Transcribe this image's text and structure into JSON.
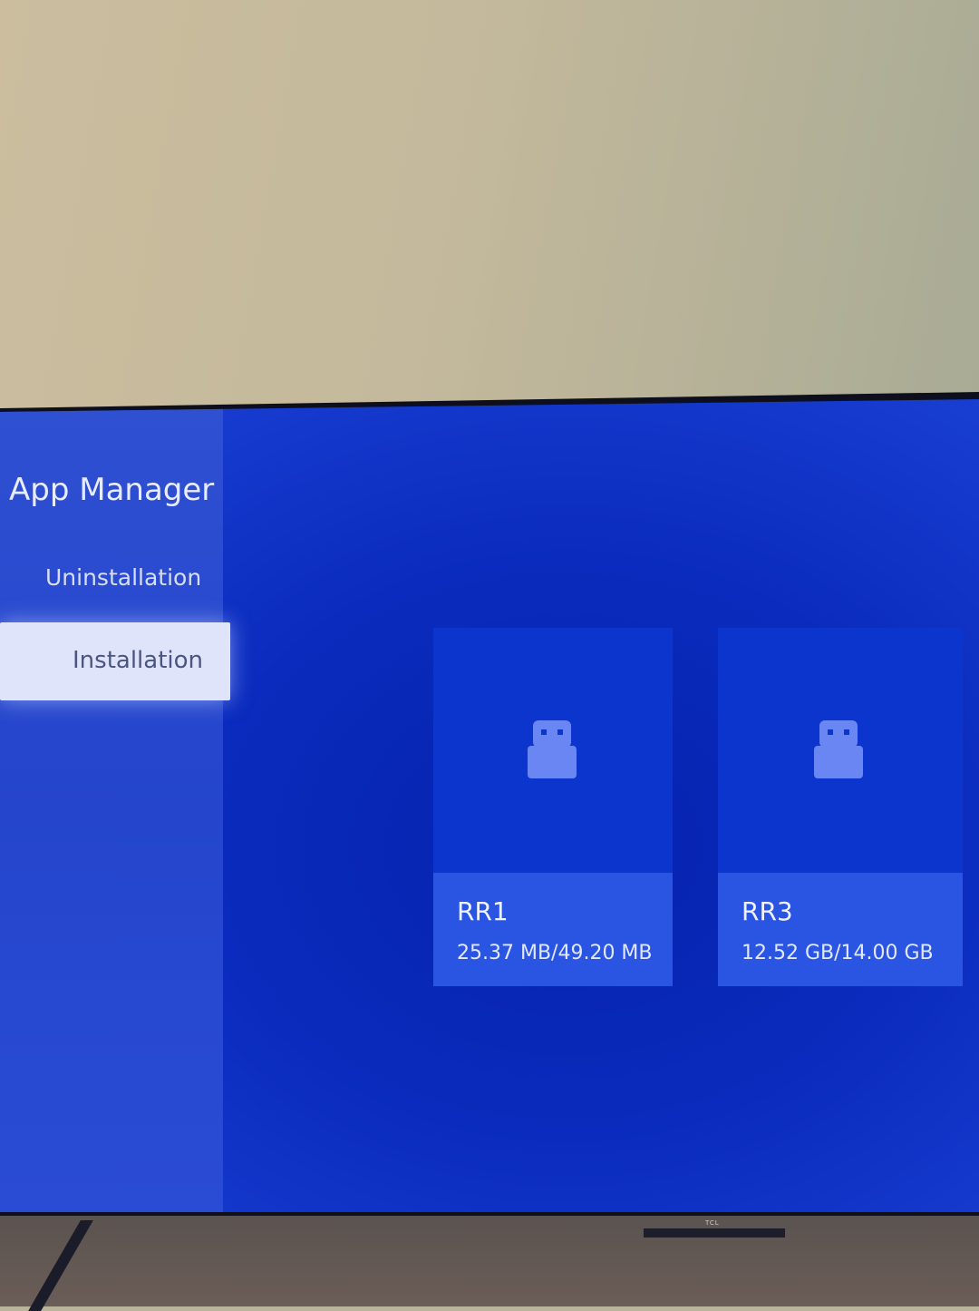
{
  "app": {
    "title": "App Manager"
  },
  "sidebar": {
    "items": [
      {
        "label": "Uninstallation",
        "selected": false
      },
      {
        "label": "Installation",
        "selected": true
      }
    ]
  },
  "devices": [
    {
      "name": "RR1",
      "storage": "25.37 MB/49.20 MB",
      "icon": "usb-drive-icon"
    },
    {
      "name": "RR3",
      "storage": "12.52 GB/14.00 GB",
      "icon": "usb-drive-icon"
    }
  ],
  "tv": {
    "brand": "TCL"
  },
  "colors": {
    "screen_blue": "#0a2bbd",
    "selected_item_bg": "#dfe4fb",
    "card_top": "#0b35cc",
    "card_bottom": "#2a55e2",
    "icon": "#6a86f2"
  }
}
